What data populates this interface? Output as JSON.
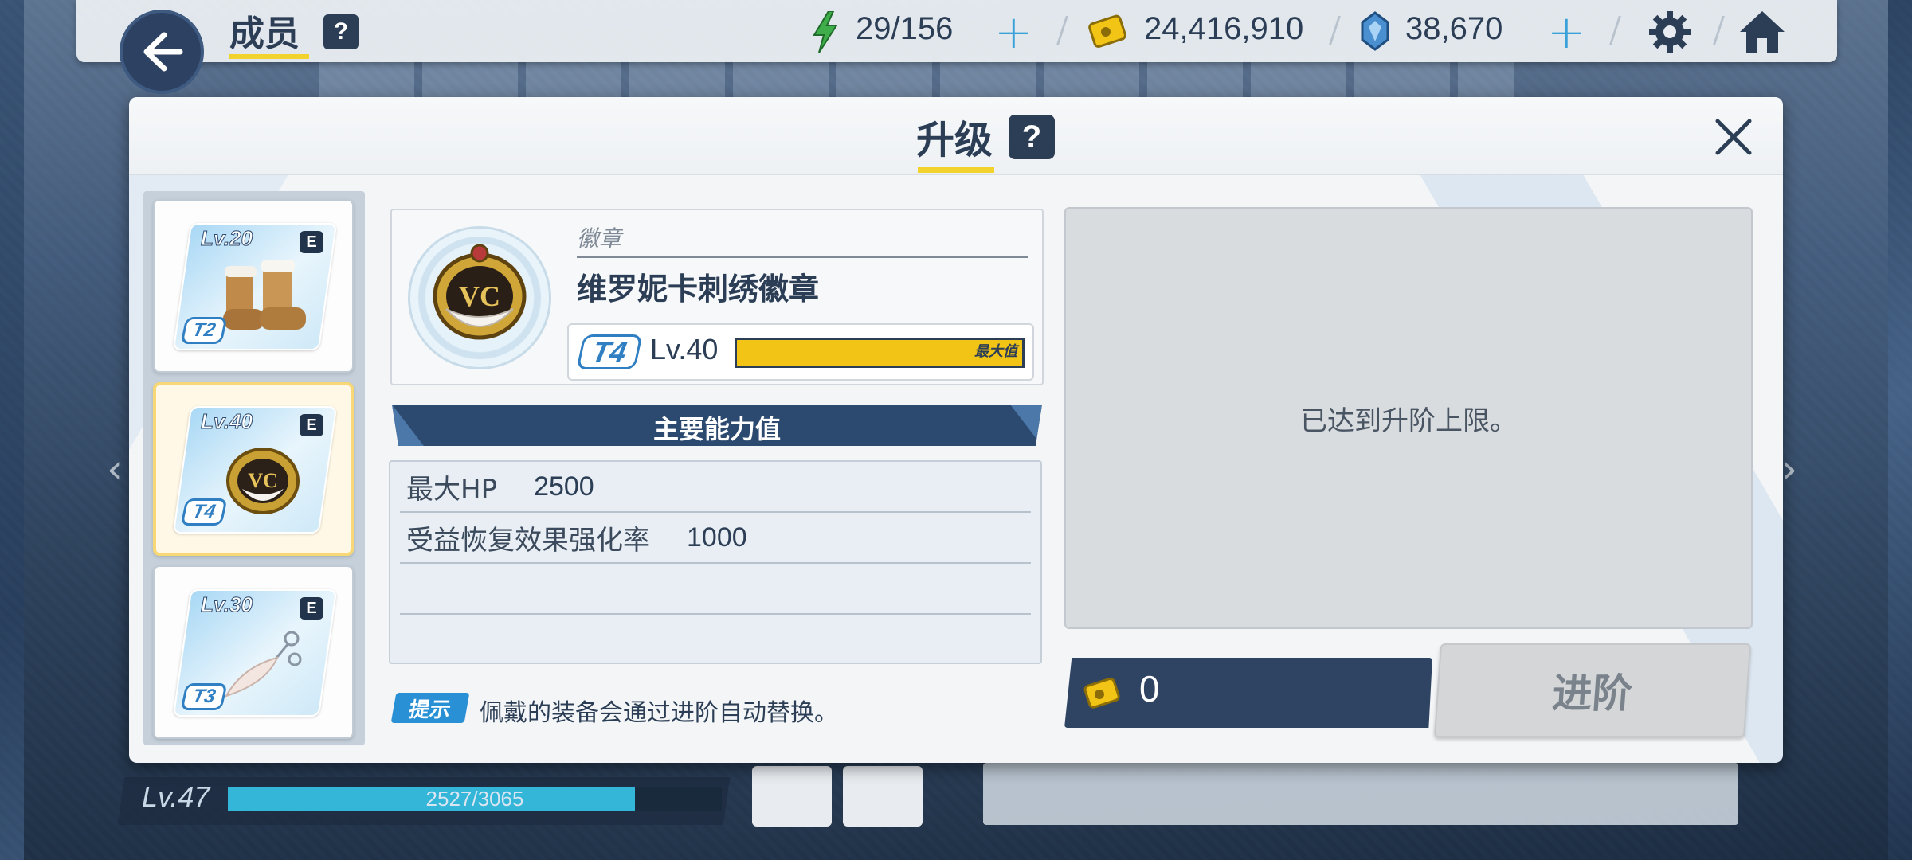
{
  "topbar": {
    "title": "成员",
    "help": "?",
    "energy": "29/156",
    "gold": "24,416,910",
    "gems": "38,670",
    "plus": "+"
  },
  "dialog": {
    "title": "升级",
    "help": "?"
  },
  "equipment_list": [
    {
      "level": "Lv.20",
      "grade": "E",
      "tier": "T2",
      "icon": "boots-icon",
      "selected": false
    },
    {
      "level": "Lv.40",
      "grade": "E",
      "tier": "T4",
      "icon": "badge-icon",
      "selected": true
    },
    {
      "level": "Lv.30",
      "grade": "E",
      "tier": "T3",
      "icon": "feather-charm-icon",
      "selected": false
    }
  ],
  "item": {
    "category": "徽章",
    "name": "维罗妮卡刺绣徽章",
    "tier": "T4",
    "level": "Lv.40",
    "level_progress": 1.0,
    "max_label": "最大值"
  },
  "stats": {
    "title": "主要能力值",
    "rows": [
      {
        "name": "最大HP",
        "value": "2500"
      },
      {
        "name": "受益恢复效果强化率",
        "value": "1000"
      },
      {
        "name": "",
        "value": ""
      }
    ]
  },
  "hint": {
    "badge": "提示",
    "text": "佩戴的装备会通过进阶自动替换。"
  },
  "result": {
    "message": "已达到升阶上限。"
  },
  "cost": {
    "value": "0"
  },
  "advance_button": "进阶",
  "bottom": {
    "level": "Lv.47",
    "exp": "2527/3065",
    "exp_fraction": 0.824
  },
  "colors": {
    "accent_yellow": "#f2d32d",
    "navy": "#2c3e55",
    "tier_blue": "#2f7fc2",
    "level_bar": "#f2c416"
  }
}
